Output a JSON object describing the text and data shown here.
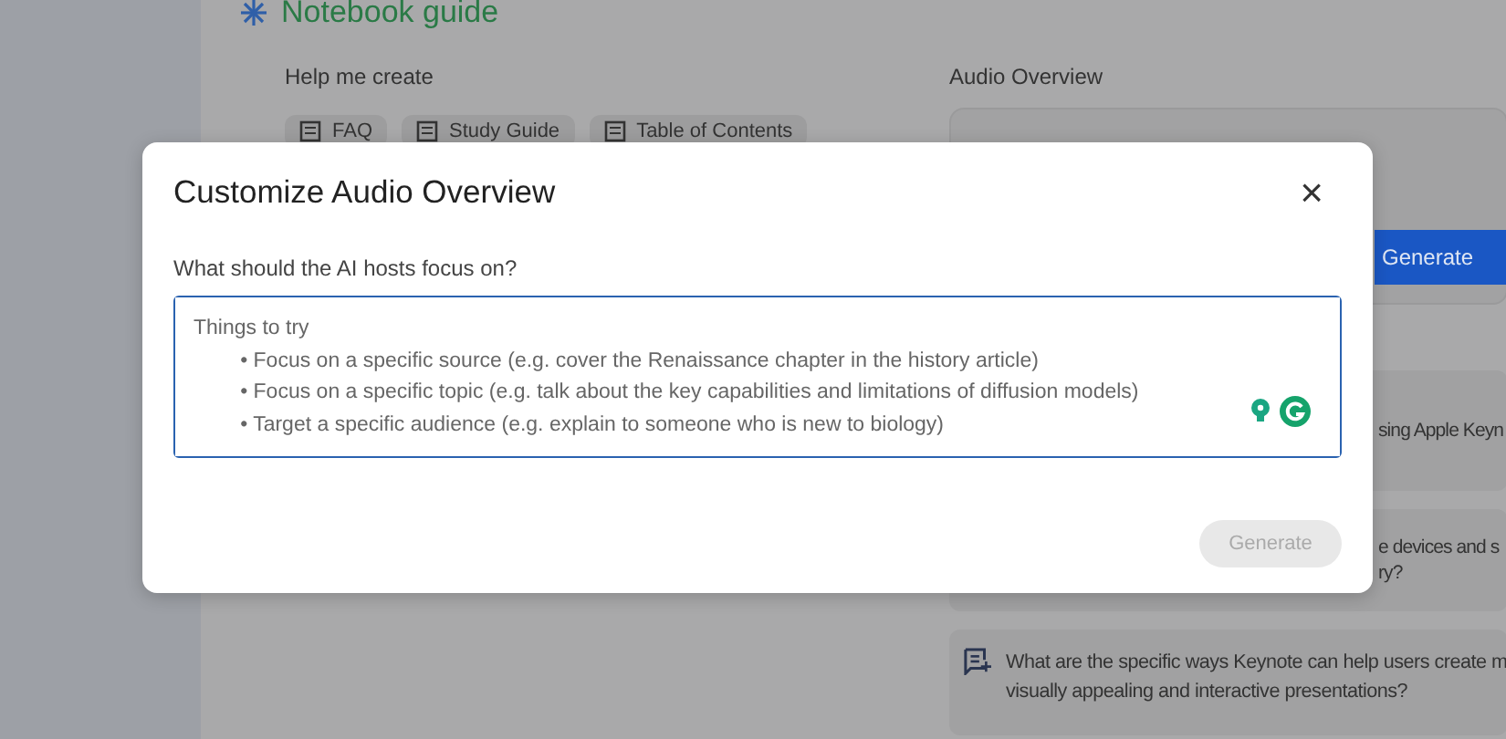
{
  "background_page": {
    "title": "Notebook guide",
    "help_section": {
      "label": "Help me create",
      "chips": [
        "FAQ",
        "Study Guide",
        "Table of Contents"
      ]
    },
    "audio_section": {
      "label": "Audio Overview",
      "generate_button": "Generate"
    },
    "suggestion_fragments": [
      {
        "lines": [
          "sing Apple Keyn"
        ]
      },
      {
        "lines": [
          "e devices and s",
          "ry?"
        ]
      }
    ],
    "question_card": {
      "text": "What are the specific ways Keynote can help users create m\nvisually appealing and interactive presentations?"
    }
  },
  "dialog": {
    "title": "Customize Audio Overview",
    "close": "×",
    "prompt_label": "What should the AI hosts focus on?",
    "focus_field": {
      "placeholder": "Things to try\n        • Focus on a specific source (e.g. cover the Renaissance chapter in the history article)\n        • Focus on a specific topic (e.g. talk about the key capabilities and limitations of diffusion models)\n        • Target a specific audience (e.g. explain to someone who is new to biology)"
    },
    "generate_button": {
      "label": "Generate",
      "disabled": true
    }
  }
}
